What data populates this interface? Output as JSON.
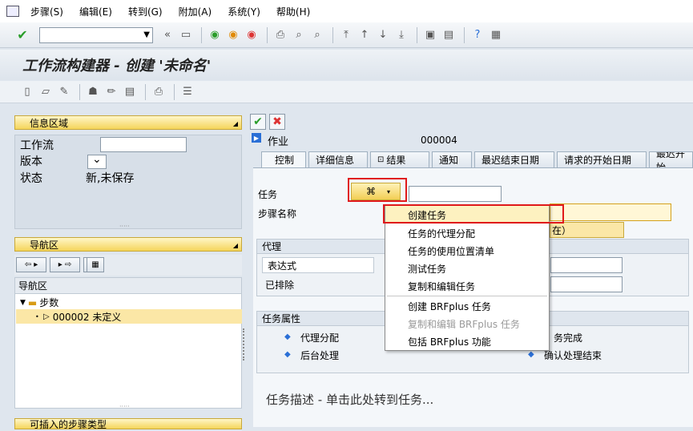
{
  "menubar": {
    "items": [
      "步骤(S)",
      "编辑(E)",
      "转到(G)",
      "附加(A)",
      "系统(Y)",
      "帮助(H)"
    ]
  },
  "toolbar": {
    "command_value": "",
    "icons": [
      "enter-icon",
      "back-icon",
      "exit-icon",
      "cancel-icon",
      "save-icon",
      "print-icon",
      "find-icon",
      "first-page-icon",
      "prev-page-icon",
      "next-page-icon",
      "last-page-icon",
      "help-icon",
      "customize-icon"
    ]
  },
  "title": "工作流构建器 - 创建 '未命名'",
  "info_panel": {
    "header": "信息区域",
    "rows": [
      {
        "label": "工作流",
        "value": ""
      },
      {
        "label": "版本",
        "value": ""
      },
      {
        "label": "状态",
        "value": "新,未保存"
      }
    ]
  },
  "nav_panel": {
    "header": "导航区",
    "tree_header": "导航区",
    "root": "步数",
    "child": "000002 未定义"
  },
  "insert_panel": {
    "header": "可插入的步骤类型"
  },
  "step": {
    "type_label": "作业",
    "number": "000004"
  },
  "tabs": [
    "控制",
    "详细信息",
    "结果",
    "通知",
    "最迟结束日期",
    "请求的开始日期",
    "最迟开始"
  ],
  "form": {
    "task_label": "任务",
    "step_name_label": "步骤名称",
    "behind_button_text": "在）",
    "agent_group": "代理",
    "expression_label": "表达式",
    "excluded_label": "已排除",
    "task_props_group": "任务属性",
    "props": [
      "代理分配",
      "后台处理",
      "务完成",
      "确认处理结束"
    ],
    "description": "任务描述 - 单击此处转到任务..."
  },
  "context_menu": {
    "items": [
      {
        "label": "创建任务",
        "disabled": false,
        "highlighted": true
      },
      {
        "label": "任务的代理分配",
        "disabled": false,
        "highlighted": false
      },
      {
        "label": "任务的使用位置清单",
        "disabled": false,
        "highlighted": false
      },
      {
        "label": "测试任务",
        "disabled": false,
        "highlighted": false
      },
      {
        "label": "复制和编辑任务",
        "disabled": false,
        "highlighted": false
      },
      {
        "label": "创建 BRFplus 任务",
        "disabled": false,
        "highlighted": false
      },
      {
        "label": "复制和编辑 BRFplus 任务",
        "disabled": true,
        "highlighted": false
      },
      {
        "label": "包括 BRFplus 功能",
        "disabled": false,
        "highlighted": false
      }
    ]
  },
  "colors": {
    "highlight_box": "#e0191b",
    "panel_header": "#f5d55a",
    "menu_highlight": "#fdf1c0"
  }
}
